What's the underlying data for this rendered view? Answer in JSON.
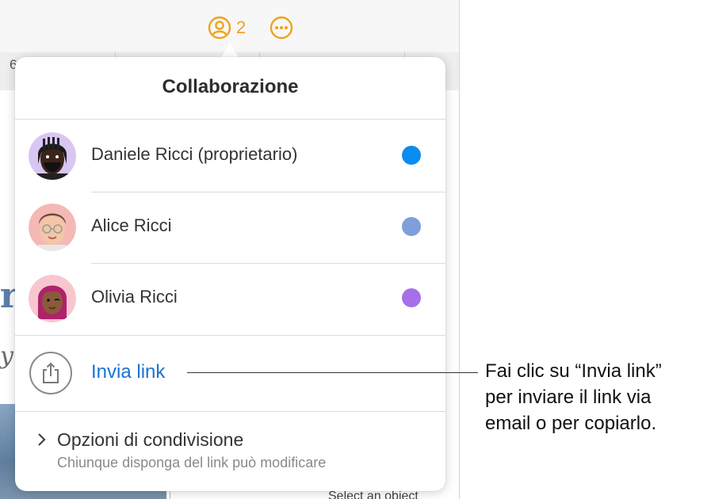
{
  "toolbar": {
    "collaborator_count": "2",
    "ruler_number": "6"
  },
  "document": {
    "glyph_1": "r",
    "glyph_2": "y",
    "status_text": "Select an object"
  },
  "popover": {
    "title": "Collaborazione",
    "participants": [
      {
        "name": "Daniele Ricci (proprietario)",
        "color": "#0a8cf0",
        "avatar": "memoji-man-beard-avatar"
      },
      {
        "name": "Alice Ricci",
        "color": "#7e9fdc",
        "avatar": "memoji-glasses-avatar"
      },
      {
        "name": "Olivia Ricci",
        "color": "#a770e8",
        "avatar": "memoji-pink-hair-avatar"
      }
    ],
    "send_link_label": "Invia link",
    "send_link_icon": "share-icon",
    "sharing_options_title": "Opzioni di condivisione",
    "sharing_options_subtitle": "Chiunque disponga del link può modificare"
  },
  "callout": {
    "lines": [
      "Fai clic su “Invia link”",
      "per inviare il link via",
      "email o per copiarlo."
    ]
  },
  "colors": {
    "accent_orange": "#f0a21a",
    "link_blue": "#1a72d4"
  }
}
